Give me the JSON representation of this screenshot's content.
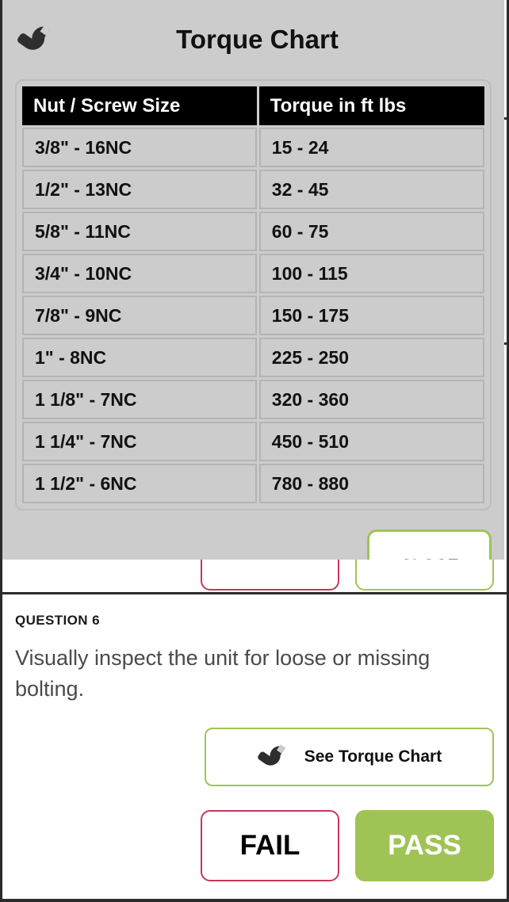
{
  "modal": {
    "title": "Torque Chart",
    "icon": "wrench-icon",
    "table": {
      "headers": [
        "Nut / Screw Size",
        "Torque in ft lbs"
      ],
      "rows": [
        [
          "3/8\" - 16NC",
          "15 - 24"
        ],
        [
          "1/2\" - 13NC",
          "32 - 45"
        ],
        [
          "5/8\" - 11NC",
          "60 - 75"
        ],
        [
          "3/4\" - 10NC",
          "100 - 115"
        ],
        [
          "7/8\" - 9NC",
          "150 - 175"
        ],
        [
          "1\" - 8NC",
          "225 - 250"
        ],
        [
          "1 1/8\" - 7NC",
          "320 - 360"
        ],
        [
          "1 1/4\" - 7NC",
          "450 - 510"
        ],
        [
          "1 1/2\" - 6NC",
          "780 - 880"
        ]
      ]
    },
    "close_label": "CLOSE"
  },
  "question": {
    "number_label": "QUESTION 6",
    "text": "Visually inspect the unit for loose or missing bolting.",
    "torque_button_label": "See Torque Chart",
    "torque_button_icon": "wrench-icon",
    "fail_label": "FAIL",
    "pass_label": "PASS"
  },
  "colors": {
    "green": "#9FC455",
    "crimson": "#C8375A",
    "overlay_gray": "#cccccc",
    "header_black": "#000000",
    "frame_dark": "#2b2b2b"
  }
}
